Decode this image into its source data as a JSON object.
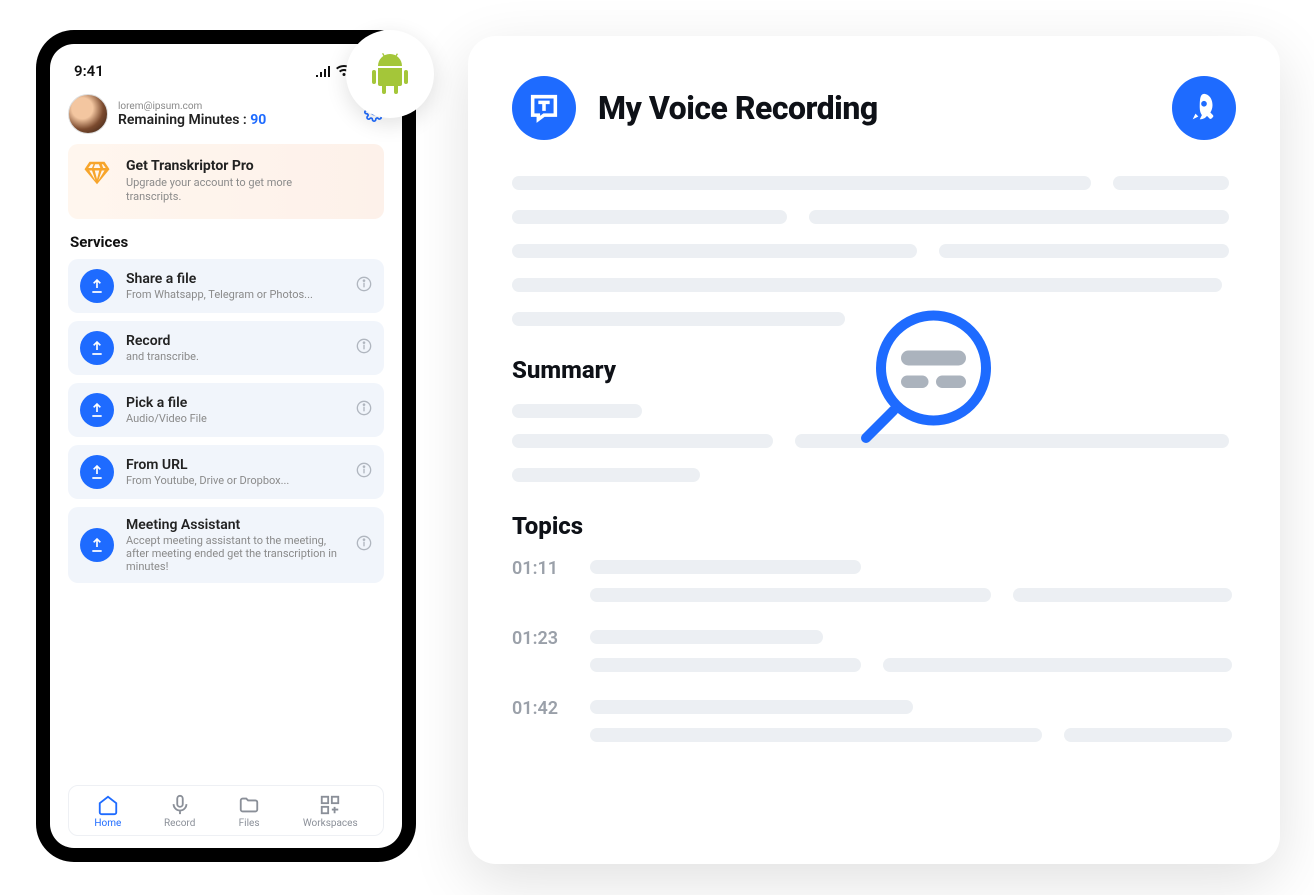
{
  "phone": {
    "status_time": "9:41",
    "user": {
      "email": "lorem@ipsum.com",
      "minutes_label": "Remaining Minutes :",
      "minutes_value": "90"
    },
    "promo": {
      "title": "Get Transkriptor Pro",
      "subtitle": "Upgrade your account to get more transcripts."
    },
    "services_label": "Services",
    "services": [
      {
        "title": "Share a file",
        "subtitle": "From Whatsapp, Telegram or Photos..."
      },
      {
        "title": "Record",
        "subtitle": "and transcribe."
      },
      {
        "title": "Pick a file",
        "subtitle": "Audio/Video File"
      },
      {
        "title": "From URL",
        "subtitle": "From Youtube, Drive or Dropbox..."
      },
      {
        "title": "Meeting Assistant",
        "subtitle": "Accept meeting assistant to the meeting, after meeting ended get the transcription in minutes!"
      }
    ],
    "tabs": [
      {
        "name": "home",
        "label": "Home"
      },
      {
        "name": "record",
        "label": "Record"
      },
      {
        "name": "files",
        "label": "Files"
      },
      {
        "name": "workspaces",
        "label": "Workspaces"
      }
    ]
  },
  "panel": {
    "title": "My Voice Recording",
    "summary_label": "Summary",
    "topics_label": "Topics",
    "topics": [
      {
        "time": "01:11"
      },
      {
        "time": "01:23"
      },
      {
        "time": "01:42"
      }
    ]
  },
  "icons": {
    "upload": "upload-icon",
    "info": "info-icon",
    "gear": "gear-icon",
    "android": "android-icon",
    "brand": "brand-icon",
    "rocket": "rocket-icon",
    "magnifier": "magnifier-icon",
    "diamond": "diamond-icon"
  }
}
